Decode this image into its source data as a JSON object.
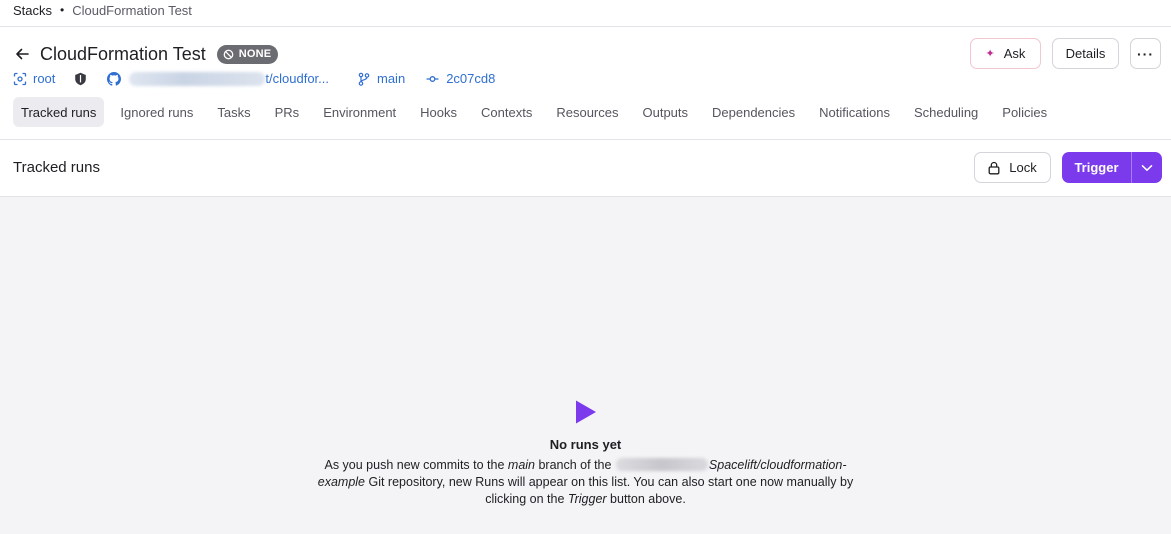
{
  "breadcrumb": {
    "root": "Stacks",
    "separator": "•",
    "current": "CloudFormation Test"
  },
  "header": {
    "title": "CloudFormation Test",
    "status": "NONE",
    "ask_label": "Ask",
    "details_label": "Details",
    "more_label": "···"
  },
  "meta": {
    "space": "root",
    "repo_tail": "t/cloudfor...",
    "branch": "main",
    "commit": "2c07cd8"
  },
  "tabs": [
    {
      "label": "Tracked runs",
      "active": true
    },
    {
      "label": "Ignored runs"
    },
    {
      "label": "Tasks"
    },
    {
      "label": "PRs"
    },
    {
      "label": "Environment"
    },
    {
      "label": "Hooks"
    },
    {
      "label": "Contexts"
    },
    {
      "label": "Resources"
    },
    {
      "label": "Outputs"
    },
    {
      "label": "Dependencies"
    },
    {
      "label": "Notifications"
    },
    {
      "label": "Scheduling"
    },
    {
      "label": "Policies"
    }
  ],
  "section": {
    "title": "Tracked runs",
    "lock_label": "Lock",
    "trigger_label": "Trigger"
  },
  "empty": {
    "title": "No runs yet",
    "text_1": "As you push new commits to the ",
    "branch": "main",
    "text_2": " branch of the ",
    "repo": "Spacelift/cloudformation-example",
    "text_3": " Git repository, new Runs will appear on this list. You can also start one now manually by clicking on the ",
    "trigger": "Trigger",
    "text_4": " button above."
  },
  "colors": {
    "accent": "#7c3aed",
    "link": "#2f6fd1",
    "badge": "#6b6b72",
    "content_bg": "#f4f4f6"
  },
  "icons": {
    "back": "arrow-left-icon",
    "status": "ban-icon",
    "ask": "sparkle-icon",
    "space": "space-icon",
    "shield": "shield-icon",
    "github": "github-icon",
    "branch": "git-branch-icon",
    "commit": "git-commit-icon",
    "lock": "lock-icon",
    "dropdown": "chevron-down-icon",
    "empty": "play-icon"
  }
}
